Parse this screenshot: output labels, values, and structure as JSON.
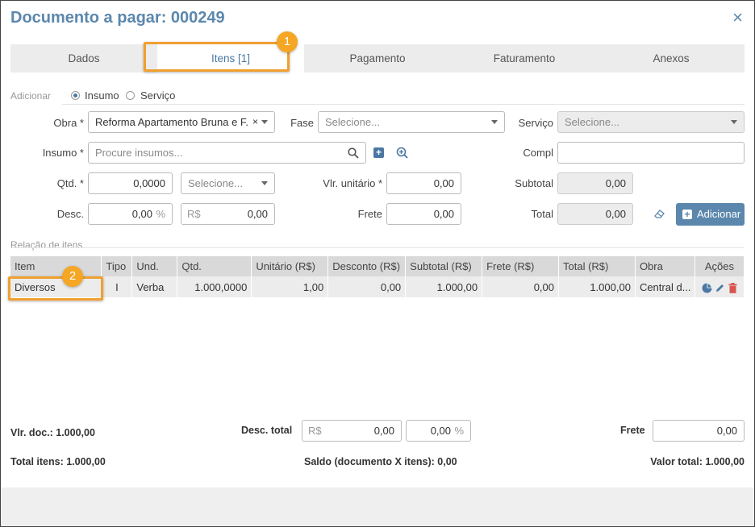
{
  "dialog": {
    "title": "Documento a pagar: 000249",
    "close_label": "×"
  },
  "tabs": [
    {
      "label": "Dados",
      "active": false
    },
    {
      "label": "Itens [1]",
      "active": true
    },
    {
      "label": "Pagamento",
      "active": false
    },
    {
      "label": "Faturamento",
      "active": false
    },
    {
      "label": "Anexos",
      "active": false
    }
  ],
  "badges": {
    "first": "1",
    "second": "2"
  },
  "add_section": {
    "label": "Adicionar",
    "radio_insumo": "Insumo",
    "radio_servico": "Serviço",
    "selected": "Insumo"
  },
  "form": {
    "obra_label": "Obra *",
    "obra_value": "Reforma Apartamento Bruna e F...",
    "fase_label": "Fase",
    "fase_placeholder": "Selecione...",
    "servico_label": "Serviço",
    "servico_placeholder": "Selecione...",
    "insumo_label": "Insumo *",
    "insumo_placeholder": "Procure insumos...",
    "compl_label": "Compl",
    "compl_value": "",
    "qtd_label": "Qtd. *",
    "qtd_value": "0,0000",
    "unit_placeholder": "Selecione...",
    "vlr_unit_label": "Vlr. unitário *",
    "vlr_unit_value": "0,00",
    "subtotal_label": "Subtotal",
    "subtotal_value": "0,00",
    "desc_label": "Desc.",
    "desc_pct_value": "0,00",
    "pct_symbol": "%",
    "currency_symbol": "R$",
    "desc_rs_value": "0,00",
    "frete_label": "Frete",
    "frete_value": "0,00",
    "total_label": "Total",
    "total_value": "0,00",
    "add_button": "Adicionar",
    "search_icon": "search-icon",
    "add_icon": "plus-square-icon",
    "zoom_icon": "zoom-in-icon",
    "eraser_icon": "eraser-icon"
  },
  "items_section": {
    "label": "Relação de itens"
  },
  "table": {
    "headers": [
      "Item",
      "Tipo",
      "Und.",
      "Qtd.",
      "Unitário (R$)",
      "Desconto (R$)",
      "Subtotal (R$)",
      "Frete (R$)",
      "Total (R$)",
      "Obra",
      "Ações"
    ],
    "rows": [
      {
        "item": "Diversos",
        "tipo": "I",
        "und": "Verba",
        "qtd": "1.000,0000",
        "unitario": "1,00",
        "desconto": "0,00",
        "subtotal": "1.000,00",
        "frete": "0,00",
        "total": "1.000,00",
        "obra": "Central d..."
      }
    ]
  },
  "footer": {
    "vlr_doc": "Vlr. doc.: 1.000,00",
    "desc_total_label": "Desc. total",
    "desc_total_rs": "0,00",
    "desc_total_pct": "0,00",
    "frete_label": "Frete",
    "frete_value": "0,00",
    "total_itens": "Total itens: 1.000,00",
    "saldo": "Saldo (documento X itens): 0,00",
    "valor_total": "Valor total: 1.000,00"
  },
  "colors": {
    "accent": "#5b87ad",
    "highlight": "#f0a030",
    "badge": "#f5a623",
    "delete": "#d9534f"
  }
}
